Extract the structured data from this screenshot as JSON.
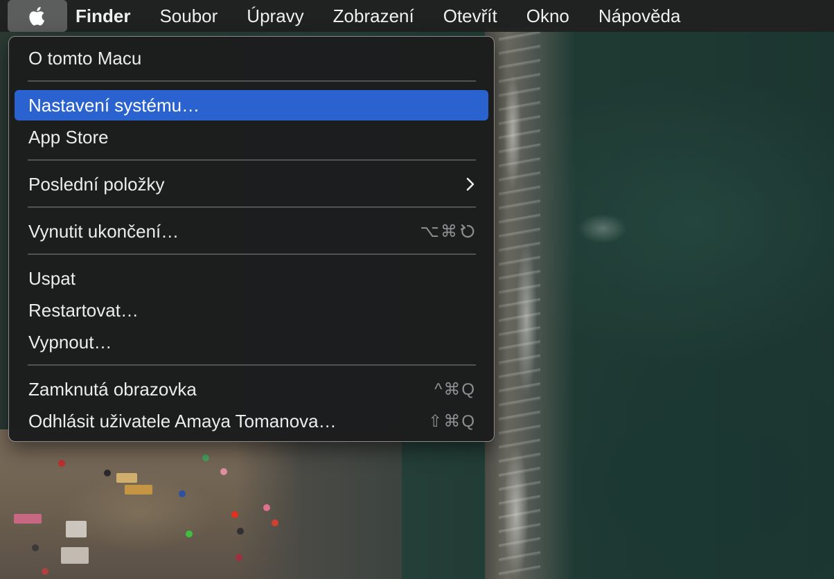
{
  "menubar": {
    "apple_icon": "apple-logo-icon",
    "app_name": "Finder",
    "menus": [
      "Soubor",
      "Úpravy",
      "Zobrazení",
      "Otevřít",
      "Okno",
      "Nápověda"
    ]
  },
  "apple_menu": {
    "about": "O tomto Macu",
    "system_settings": "Nastavení systému…",
    "app_store": "App Store",
    "recent_items": "Poslední položky",
    "force_quit": "Vynutit ukončení…",
    "force_quit_shortcut": "⌥⌘",
    "sleep": "Uspat",
    "restart": "Restartovat…",
    "shutdown": "Vypnout…",
    "lock_screen": "Zamknutá obrazovka",
    "lock_screen_shortcut": "^⌘Q",
    "logout": "Odhlásit uživatele Amaya Tomanova…",
    "logout_shortcut": "⇧⌘Q",
    "highlighted_item": "Nastavení systému…"
  },
  "colors": {
    "menubar_bg": "#202121",
    "menu_bg": "#1c1c1d",
    "highlight": "#2a62d0",
    "shortcut_text": "#8f8f93"
  }
}
